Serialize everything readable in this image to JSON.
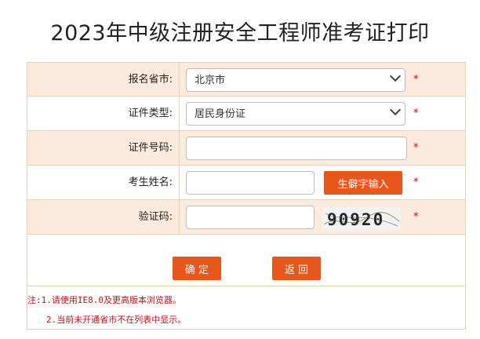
{
  "page": {
    "title": "2023年中级注册安全工程师准考证打印"
  },
  "form": {
    "province": {
      "label": "报名省市:",
      "selected": "北京市"
    },
    "id_type": {
      "label": "证件类型:",
      "selected": "居民身份证"
    },
    "id_number": {
      "label": "证件号码:",
      "value": ""
    },
    "name": {
      "label": "考生姓名:",
      "value": "",
      "rare_char_button": "生僻字输入"
    },
    "captcha": {
      "label": "验证码:",
      "value": "",
      "image_text": "90920"
    },
    "required_mark": "*"
  },
  "buttons": {
    "confirm": "确 定",
    "back": "返 回"
  },
  "notes": {
    "line1": "注:1.请使用IE8.0及更高版本浏览器。",
    "line2": "2.当前未开通省市不在列表中显示。"
  },
  "colors": {
    "accent": "#e8561a",
    "row_shade": "#fcebdc",
    "border": "#e6d2b4",
    "required": "#d0021b"
  }
}
